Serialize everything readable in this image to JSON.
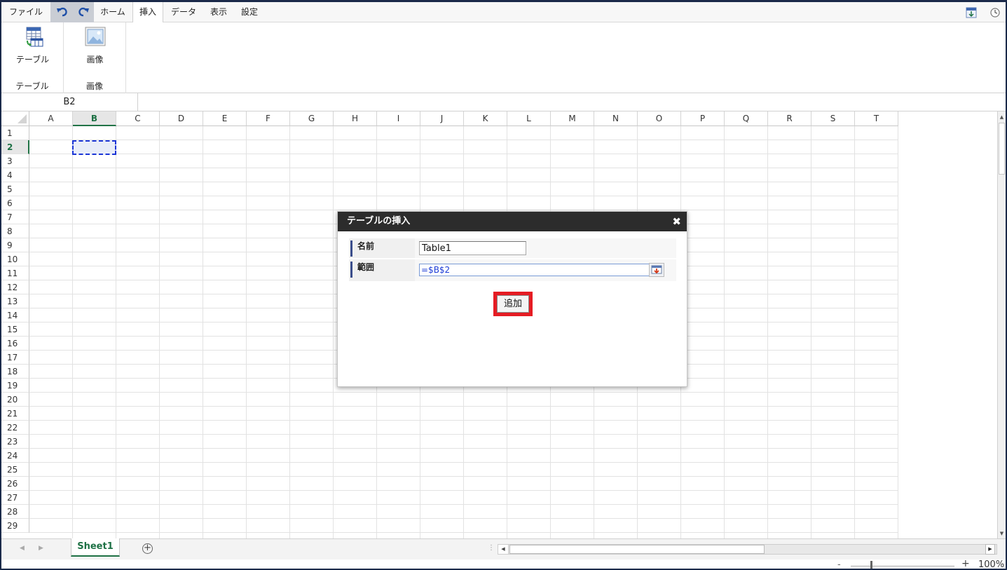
{
  "menubar": {
    "items": [
      "ファイル",
      "ホーム",
      "挿入",
      "データ",
      "表示",
      "設定"
    ],
    "active_tab": "挿入"
  },
  "ribbon": {
    "groups": [
      {
        "button_label": "テーブル",
        "group_label": "テーブル",
        "icon": "table-icon"
      },
      {
        "button_label": "画像",
        "group_label": "画像",
        "icon": "image-icon"
      }
    ]
  },
  "formula_bar": {
    "name_box": "B2",
    "formula": ""
  },
  "grid": {
    "columns": [
      "A",
      "B",
      "C",
      "D",
      "E",
      "F",
      "G",
      "H",
      "I",
      "J",
      "K",
      "L",
      "M",
      "N",
      "O",
      "P",
      "Q",
      "R",
      "S",
      "T"
    ],
    "rows": [
      "1",
      "2",
      "3",
      "4",
      "5",
      "6",
      "7",
      "8",
      "9",
      "10",
      "11",
      "12",
      "13",
      "14",
      "15",
      "16",
      "17",
      "18",
      "19",
      "20",
      "21",
      "22",
      "23",
      "24",
      "25",
      "26",
      "27",
      "28",
      "29"
    ],
    "selected_cell": "B2",
    "selected_column": "B",
    "selected_row": "2"
  },
  "dialog": {
    "title": "テーブルの挿入",
    "close_glyph": "✖",
    "fields": [
      {
        "label": "名前",
        "value": "Table1"
      },
      {
        "label": "範囲",
        "value": "=$B$2"
      }
    ],
    "add_button": "追加"
  },
  "sheets": {
    "tabs": [
      "Sheet1"
    ],
    "active": "Sheet1",
    "add_glyph": "+"
  },
  "status": {
    "zoom_minus": "-",
    "zoom_plus": "+",
    "zoom_level": "100%"
  },
  "colors": {
    "accent_green": "#1e7145",
    "selection_blue": "#1a35d6",
    "highlight_red": "#e51c23",
    "dialog_header": "#2c2c2c"
  }
}
